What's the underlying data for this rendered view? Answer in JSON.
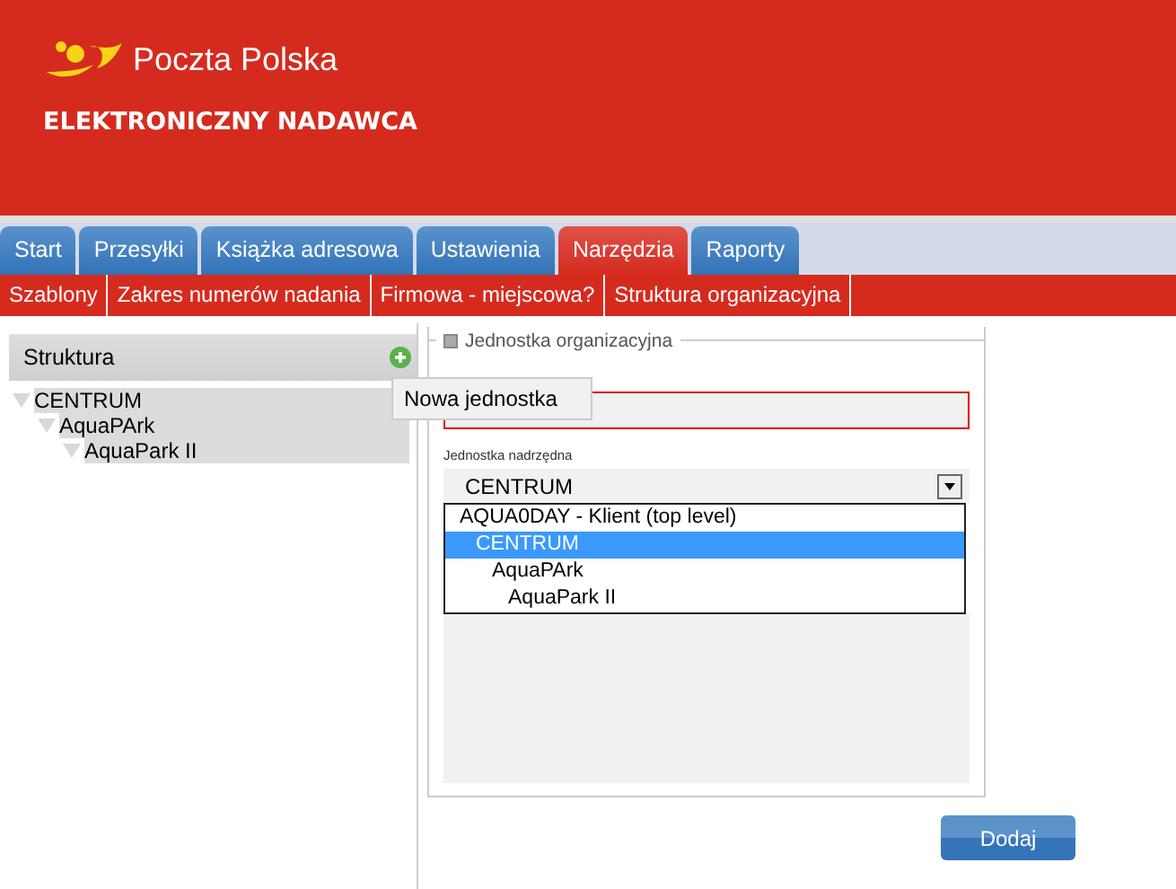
{
  "header": {
    "brand": "Poczta Polska",
    "subtitle": "ELEKTRONICZNY NADAWCA"
  },
  "tabs": [
    {
      "label": "Start",
      "selected": false
    },
    {
      "label": "Przesyłki",
      "selected": false
    },
    {
      "label": "Książka adresowa",
      "selected": false
    },
    {
      "label": "Ustawienia",
      "selected": false
    },
    {
      "label": "Narzędzia",
      "selected": true
    },
    {
      "label": "Raporty",
      "selected": false
    }
  ],
  "subnav": [
    "Szablony",
    "Zakres numerów nadania",
    "Firmowa - miejscowa?",
    "Struktura organizacyjna"
  ],
  "sidebar": {
    "title": "Struktura",
    "tree": [
      {
        "label": "CENTRUM",
        "expanded": true,
        "children": [
          {
            "label": "AquaPArk",
            "expanded": true,
            "children": [
              {
                "label": "AquaPark II",
                "expanded": true
              }
            ]
          }
        ]
      }
    ]
  },
  "tooltip": "Nowa jednostka",
  "form": {
    "legend": "Jednostka organizacyjna",
    "parent_label": "Jednostka nadrzędna",
    "parent_value": "CENTRUM",
    "options": [
      {
        "label": "AQUA0DAY - Klient (top level)",
        "selected": false,
        "children": [
          {
            "label": "CENTRUM",
            "selected": true,
            "children": [
              {
                "label": "AquaPArk",
                "selected": false,
                "children": [
                  {
                    "label": "AquaPark II",
                    "selected": false
                  }
                ]
              }
            ]
          }
        ]
      }
    ]
  },
  "buttons": [
    "Dodaj"
  ]
}
